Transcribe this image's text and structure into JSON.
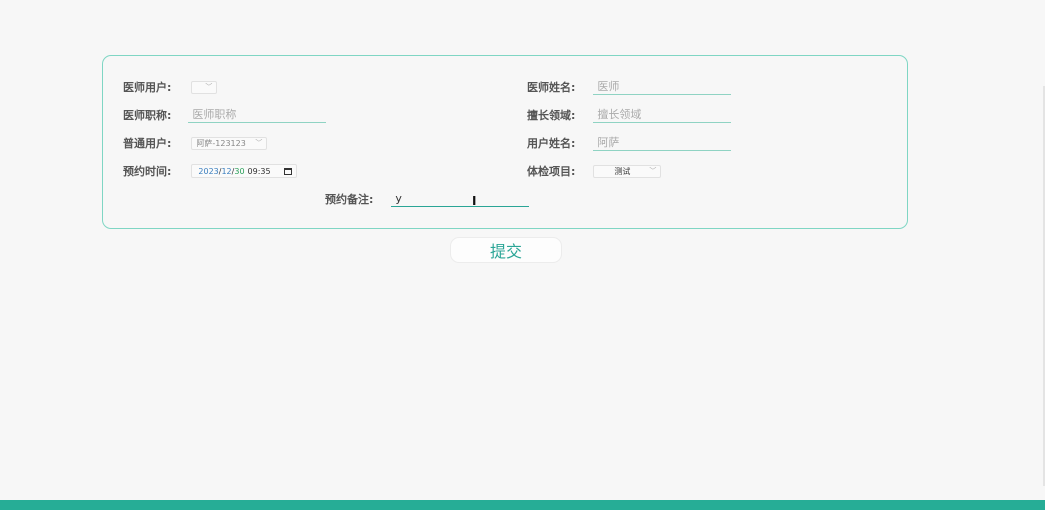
{
  "form": {
    "doctor_user": {
      "label": "医师用户:",
      "selected": ""
    },
    "doctor_name": {
      "label": "医师姓名:",
      "placeholder": "医师",
      "value": ""
    },
    "doctor_title": {
      "label": "医师职称:",
      "placeholder": "医师职称",
      "value": ""
    },
    "specialty": {
      "label": "擅长领域:",
      "placeholder": "擅长领域",
      "value": ""
    },
    "normal_user": {
      "label": "普通用户:",
      "selected": "阿萨-123123"
    },
    "user_name": {
      "label": "用户姓名:",
      "placeholder": "阿萨",
      "value": ""
    },
    "appointment_time": {
      "label": "预约时间:",
      "year": "2023",
      "month": "12",
      "day": "30",
      "time": "09:35"
    },
    "exam_item": {
      "label": "体检项目:",
      "selected": "测试"
    },
    "remark": {
      "label": "预约备注:",
      "value": "y"
    }
  },
  "submit_label": "提交",
  "colors": {
    "accent": "#26ad96",
    "card_border": "#7fd6c4",
    "submit_text": "#2aa596"
  }
}
